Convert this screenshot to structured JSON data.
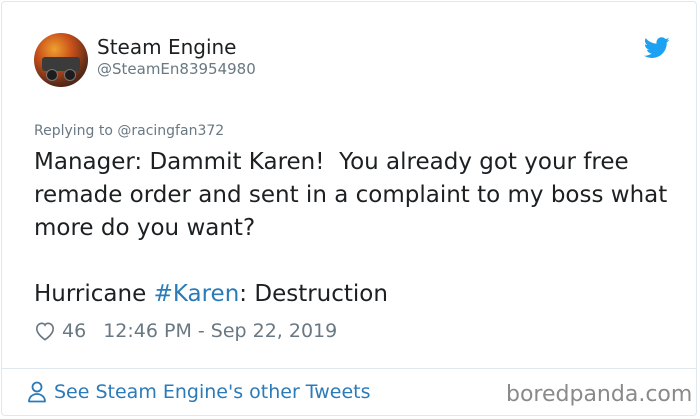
{
  "author": {
    "name": "Steam Engine",
    "handle": "@SteamEn83954980"
  },
  "tweet": {
    "replying_to": "Replying to @racingfan372",
    "text_main": "Manager: Dammit Karen!  You already got your free remade order and sent in a complaint to my boss what more do you want?",
    "hurricane_prefix": "Hurricane ",
    "hashtag": "#Karen",
    "hurricane_suffix": ": Destruction",
    "likes": "46",
    "timestamp": "12:46 PM - Sep 22, 2019"
  },
  "footer": {
    "see_more": "See Steam Engine's other Tweets",
    "watermark": "boredpanda.com"
  },
  "icons": {
    "brand": "twitter-bird-icon",
    "like": "heart-icon",
    "profile": "person-icon"
  },
  "colors": {
    "link": "#2b7bb9",
    "twitter_blue": "#1da1f2",
    "muted": "#697882",
    "text": "#1c2022"
  }
}
